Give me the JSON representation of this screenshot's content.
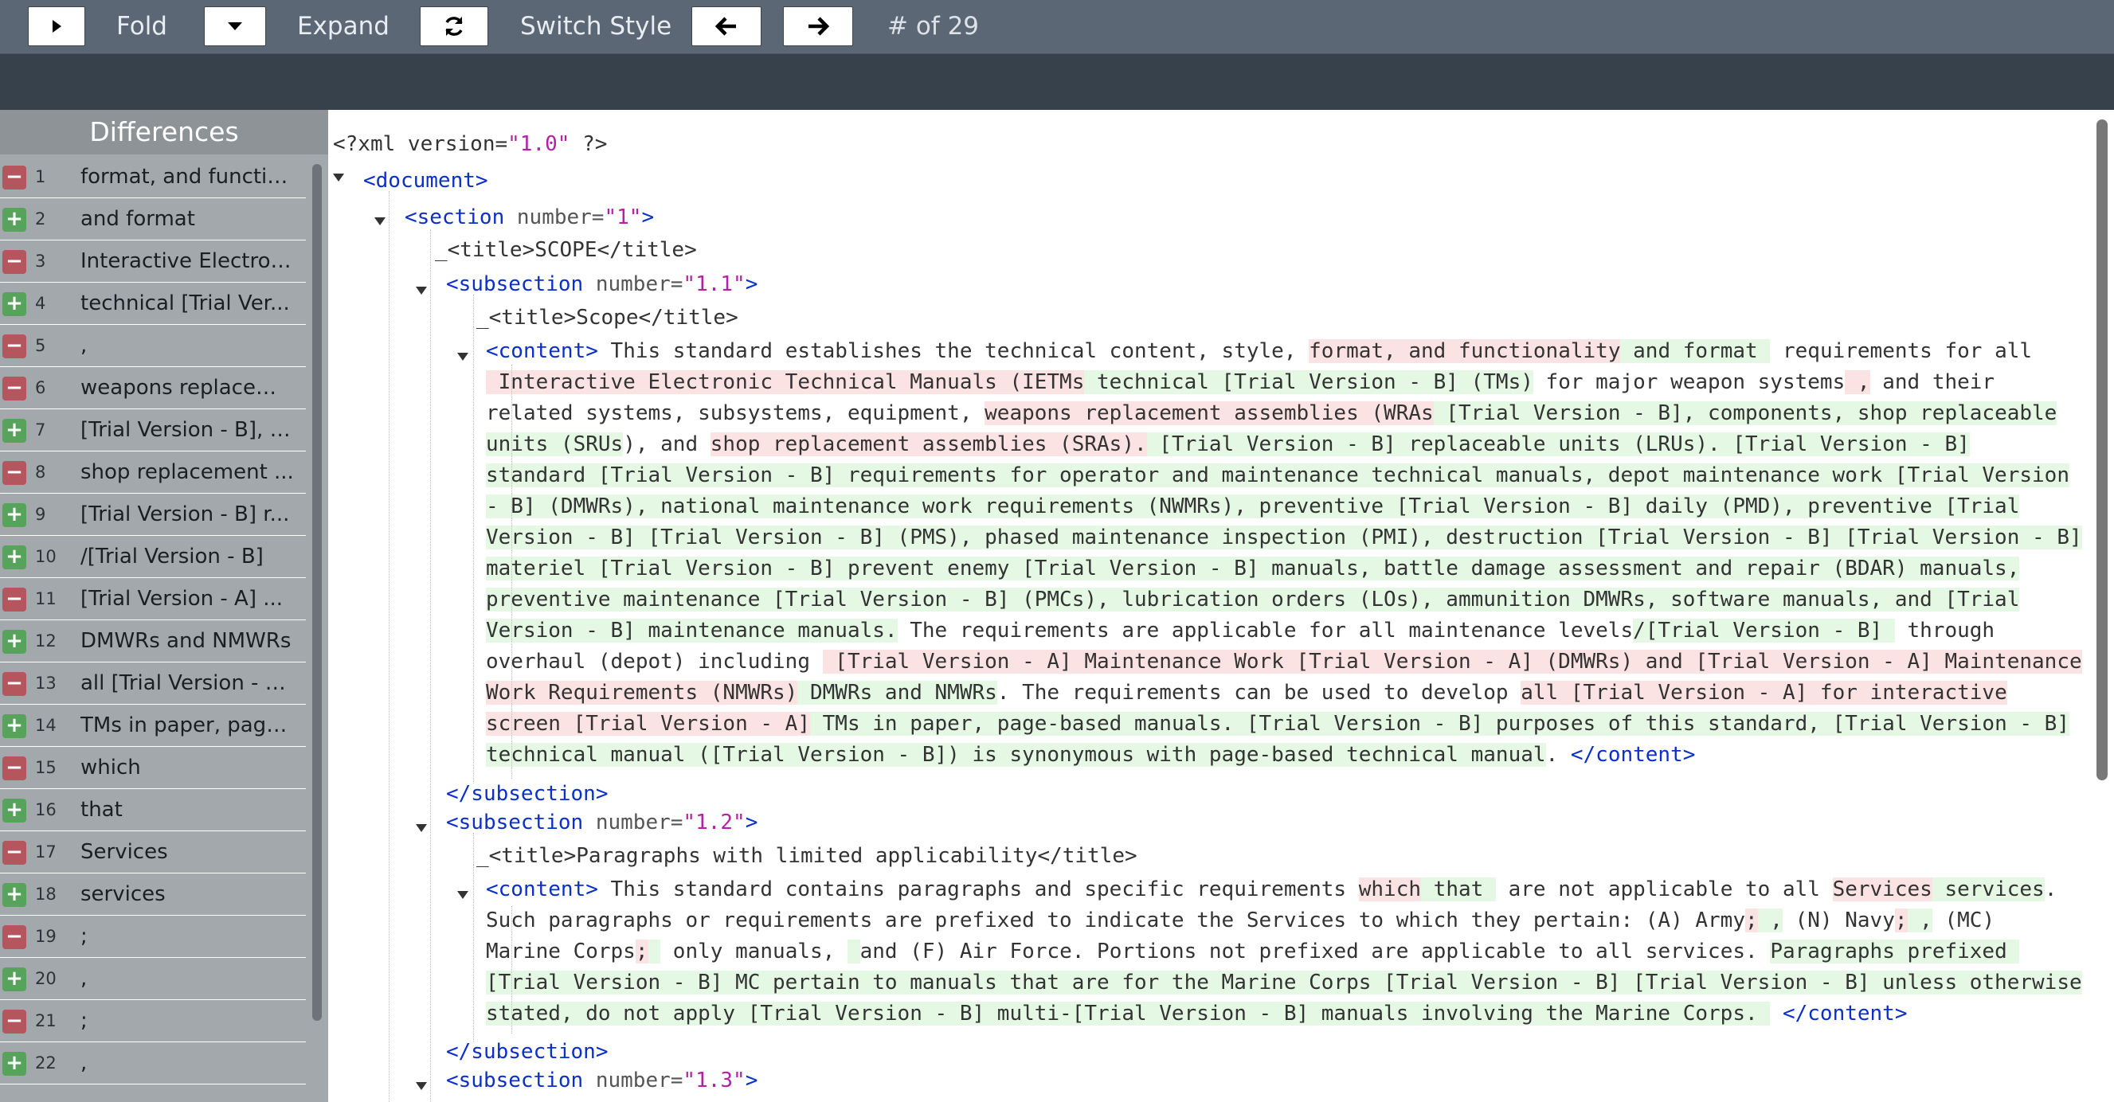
{
  "toolbar": {
    "fold_label": "Fold",
    "expand_label": "Expand",
    "switch_style_label": "Switch Style",
    "counter_label": "# of 29"
  },
  "sidebar": {
    "title": "Differences",
    "items": [
      {
        "num": "1",
        "type": "del",
        "text": "format, and functio..."
      },
      {
        "num": "2",
        "type": "add",
        "text": "and format"
      },
      {
        "num": "3",
        "type": "del",
        "text": "Interactive Electron..."
      },
      {
        "num": "4",
        "type": "add",
        "text": "technical [Trial Ver..."
      },
      {
        "num": "5",
        "type": "del",
        "text": ","
      },
      {
        "num": "6",
        "type": "del",
        "text": "weapons replacem..."
      },
      {
        "num": "7",
        "type": "add",
        "text": "[Trial Version - B], c..."
      },
      {
        "num": "8",
        "type": "del",
        "text": "shop replacement ..."
      },
      {
        "num": "9",
        "type": "add",
        "text": "[Trial Version - B] r..."
      },
      {
        "num": "10",
        "type": "add",
        "text": "/[Trial Version - B]"
      },
      {
        "num": "11",
        "type": "del",
        "text": "[Trial Version - A] ..."
      },
      {
        "num": "12",
        "type": "add",
        "text": "DMWRs and NMWRs"
      },
      {
        "num": "13",
        "type": "del",
        "text": "all [Trial Version - A..."
      },
      {
        "num": "14",
        "type": "add",
        "text": "TMs in paper, page..."
      },
      {
        "num": "15",
        "type": "del",
        "text": "which"
      },
      {
        "num": "16",
        "type": "add",
        "text": "that"
      },
      {
        "num": "17",
        "type": "del",
        "text": "Services"
      },
      {
        "num": "18",
        "type": "add",
        "text": "services"
      },
      {
        "num": "19",
        "type": "del",
        "text": ";"
      },
      {
        "num": "20",
        "type": "add",
        "text": ","
      },
      {
        "num": "21",
        "type": "del",
        "text": ";"
      },
      {
        "num": "22",
        "type": "add",
        "text": ","
      }
    ]
  },
  "xml": {
    "decl": [
      {
        "c": "plain",
        "t": "<?xml version="
      },
      {
        "c": "val",
        "t": "\"1.0\""
      },
      {
        "c": "plain",
        "t": " ?>"
      }
    ],
    "document_open": [
      {
        "c": "tag",
        "t": "<document>"
      }
    ],
    "section1_open": [
      {
        "c": "tag",
        "t": "<section"
      },
      {
        "c": "attr",
        "t": " number="
      },
      {
        "c": "val",
        "t": "\"1\""
      },
      {
        "c": "tag",
        "t": ">"
      }
    ],
    "section1_title": [
      {
        "c": "plain",
        "t": "_<title>SCOPE</title>"
      }
    ],
    "sub11_open": [
      {
        "c": "tag",
        "t": "<subsection"
      },
      {
        "c": "attr",
        "t": " number="
      },
      {
        "c": "val",
        "t": "\"1.1\""
      },
      {
        "c": "tag",
        "t": ">"
      }
    ],
    "sub11_title": [
      {
        "c": "plain",
        "t": "_<title>Scope</title>"
      }
    ],
    "sub11_content": [
      [
        {
          "c": "tag",
          "t": "<content>"
        },
        {
          "c": "plain",
          "t": " This standard establishes the technical content, style, "
        },
        {
          "c": "del",
          "t": "format, and functionality"
        },
        {
          "c": "add",
          "t": " and format "
        },
        {
          "c": "plain",
          "t": " requirements for all"
        }
      ],
      [
        {
          "c": "del",
          "t": " Interactive Electronic Technical Manuals (IETMs"
        },
        {
          "c": "add",
          "t": " technical [Trial Version - B] (TMs)"
        },
        {
          "c": "plain",
          "t": " for major weapon systems"
        },
        {
          "c": "del",
          "t": " ,"
        },
        {
          "c": "plain",
          "t": " and their"
        }
      ],
      [
        {
          "c": "plain",
          "t": "related systems, subsystems, equipment, "
        },
        {
          "c": "del",
          "t": "weapons replacement assemblies (WRAs"
        },
        {
          "c": "add",
          "t": " [Trial Version - B], components, shop replaceable"
        }
      ],
      [
        {
          "c": "add",
          "t": "units (SRUs"
        },
        {
          "c": "plain",
          "t": "), and "
        },
        {
          "c": "del",
          "t": "shop replacement assemblies (SRAs)."
        },
        {
          "c": "add",
          "t": " [Trial Version - B] replaceable units (LRUs). [Trial Version - B]"
        }
      ],
      [
        {
          "c": "add",
          "t": "standard [Trial Version - B] requirements for operator and maintenance technical manuals, depot maintenance work [Trial Version"
        }
      ],
      [
        {
          "c": "add",
          "t": "- B] (DMWRs), national maintenance work requirements (NWMRs), preventive [Trial Version - B] daily (PMD), preventive [Trial"
        }
      ],
      [
        {
          "c": "add",
          "t": "Version - B] [Trial Version - B] (PMS), phased maintenance inspection (PMI), destruction [Trial Version - B] [Trial Version - B]"
        }
      ],
      [
        {
          "c": "add",
          "t": "materiel [Trial Version - B] prevent enemy [Trial Version - B] manuals, battle damage assessment and repair (BDAR) manuals,"
        }
      ],
      [
        {
          "c": "add",
          "t": "preventive maintenance [Trial Version - B] (PMCs), lubrication orders (LOs), ammunition DMWRs, software manuals, and [Trial"
        }
      ],
      [
        {
          "c": "add",
          "t": "Version - B] maintenance manuals."
        },
        {
          "c": "plain",
          "t": " The requirements are applicable for all maintenance levels"
        },
        {
          "c": "add",
          "t": "/[Trial Version - B] "
        },
        {
          "c": "plain",
          "t": " through"
        }
      ],
      [
        {
          "c": "plain",
          "t": "overhaul (depot) including "
        },
        {
          "c": "del",
          "t": " [Trial Version - A] Maintenance Work [Trial Version - A] (DMWRs) and [Trial Version - A] Maintenance"
        }
      ],
      [
        {
          "c": "del",
          "t": "Work Requirements (NMWRs)"
        },
        {
          "c": "add",
          "t": " DMWRs and NMWRs"
        },
        {
          "c": "plain",
          "t": ". The requirements can be used to develop "
        },
        {
          "c": "del",
          "t": "all [Trial Version - A] for interactive"
        }
      ],
      [
        {
          "c": "del",
          "t": "screen [Trial Version - A]"
        },
        {
          "c": "add",
          "t": " TMs in paper, page-based manuals. [Trial Version - B] purposes of this standard, [Trial Version - B]"
        }
      ],
      [
        {
          "c": "add",
          "t": "technical manual ([Trial Version - B]) is synonymous with page-based technical manual"
        },
        {
          "c": "plain",
          "t": ". "
        },
        {
          "c": "tag",
          "t": "</content>"
        }
      ]
    ],
    "sub11_close": [
      {
        "c": "tag",
        "t": "</subsection>"
      }
    ],
    "sub12_open": [
      {
        "c": "tag",
        "t": "<subsection"
      },
      {
        "c": "attr",
        "t": " number="
      },
      {
        "c": "val",
        "t": "\"1.2\""
      },
      {
        "c": "tag",
        "t": ">"
      }
    ],
    "sub12_title": [
      {
        "c": "plain",
        "t": "_<title>Paragraphs with limited applicability</title>"
      }
    ],
    "sub12_content": [
      [
        {
          "c": "tag",
          "t": "<content>"
        },
        {
          "c": "plain",
          "t": " This standard contains paragraphs and specific requirements "
        },
        {
          "c": "del",
          "t": "which"
        },
        {
          "c": "add",
          "t": " that "
        },
        {
          "c": "plain",
          "t": " are not applicable to all "
        },
        {
          "c": "del",
          "t": "Services"
        },
        {
          "c": "add",
          "t": " services"
        },
        {
          "c": "plain",
          "t": "."
        }
      ],
      [
        {
          "c": "plain",
          "t": "Such paragraphs or requirements are prefixed to indicate the Services to which they pertain: (A) Army"
        },
        {
          "c": "del",
          "t": ";"
        },
        {
          "c": "add",
          "t": " ,"
        },
        {
          "c": "plain",
          "t": " (N) Navy"
        },
        {
          "c": "del",
          "t": ";"
        },
        {
          "c": "add",
          "t": " ,"
        },
        {
          "c": "plain",
          "t": " (MC)"
        }
      ],
      [
        {
          "c": "plain",
          "t": "Marine Corps"
        },
        {
          "c": "del",
          "t": ";"
        },
        {
          "c": "add",
          "t": " "
        },
        {
          "c": "plain",
          "t": " only manuals, "
        },
        {
          "c": "add",
          "t": " "
        },
        {
          "c": "plain",
          "t": "and (F) Air Force. Portions not prefixed are applicable to all services. "
        },
        {
          "c": "add",
          "t": "Paragraphs prefixed "
        }
      ],
      [
        {
          "c": "add",
          "t": "[Trial Version - B] MC pertain to manuals that are for the Marine Corps [Trial Version - B] [Trial Version - B] unless otherwise"
        }
      ],
      [
        {
          "c": "add",
          "t": "stated, do not apply [Trial Version - B] multi-[Trial Version - B] manuals involving the Marine Corps. "
        },
        {
          "c": "plain",
          "t": " "
        },
        {
          "c": "tag",
          "t": "</content>"
        }
      ]
    ],
    "sub12_close": [
      {
        "c": "tag",
        "t": "</subsection>"
      }
    ],
    "sub13_open": [
      {
        "c": "tag",
        "t": "<subsection"
      },
      {
        "c": "attr",
        "t": " number="
      },
      {
        "c": "val",
        "t": "\"1.3\""
      },
      {
        "c": "tag",
        "t": ">"
      }
    ]
  }
}
